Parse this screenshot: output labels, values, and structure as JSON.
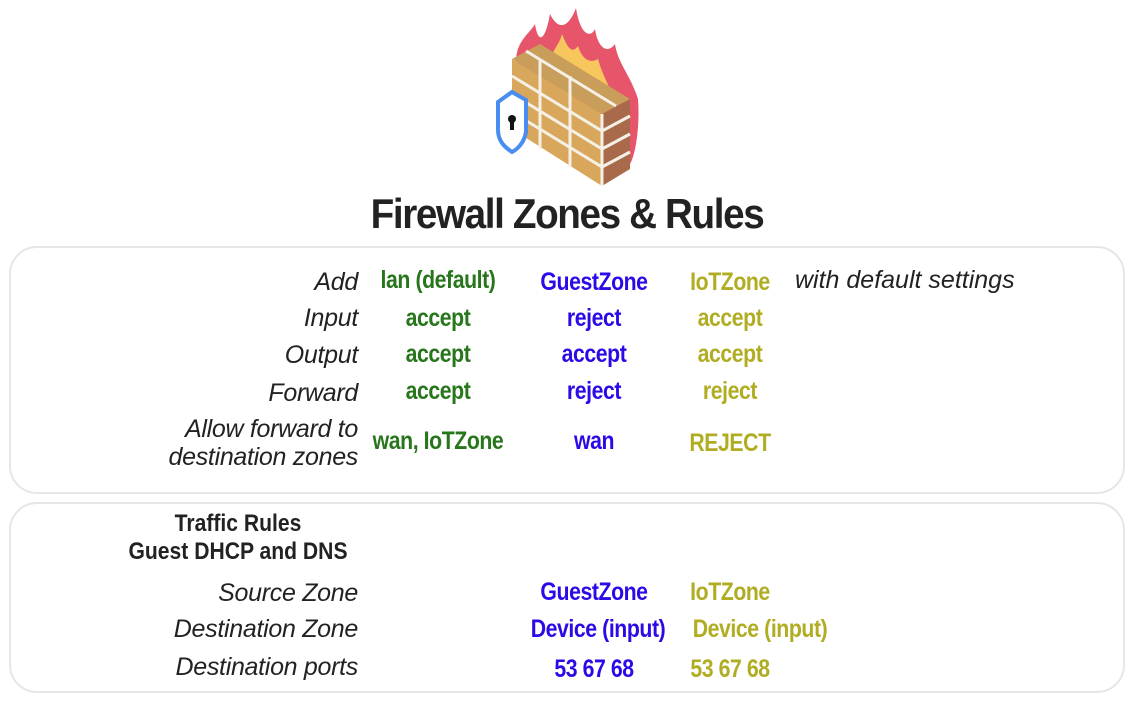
{
  "logo": {
    "icon": "firewall-brick-wall-with-flames-and-shield-icon"
  },
  "title": "Firewall Zones & Rules",
  "colors": {
    "lan": "#27761b",
    "guest": "#2a0ae6",
    "iot": "#b0ad22",
    "text": "#222222",
    "panel_border": "#e6e6e6"
  },
  "zones": {
    "add_label": "Add",
    "trailing_note": "with default settings",
    "headers": [
      "lan (default)",
      "GuestZone",
      "IoTZone"
    ],
    "rows": [
      {
        "label": "Input",
        "values": [
          "accept",
          "reject",
          "accept"
        ]
      },
      {
        "label": "Output",
        "values": [
          "accept",
          "accept",
          "accept"
        ]
      },
      {
        "label": "Forward",
        "values": [
          "accept",
          "reject",
          "reject"
        ]
      },
      {
        "label_line1": "Allow forward to",
        "label_line2": "destination zones",
        "values": [
          "wan, IoTZone",
          "wan",
          "REJECT"
        ]
      }
    ]
  },
  "traffic_rules": {
    "heading_line1": "Traffic Rules",
    "heading_line2": "Guest DHCP and DNS",
    "rows": [
      {
        "label": "Source Zone",
        "values": [
          "GuestZone",
          "IoTZone"
        ]
      },
      {
        "label": "Destination Zone",
        "values": [
          "Device (input)",
          "Device (input)"
        ]
      },
      {
        "label": "Destination ports",
        "values": [
          "53 67 68",
          "53 67 68"
        ]
      }
    ]
  }
}
